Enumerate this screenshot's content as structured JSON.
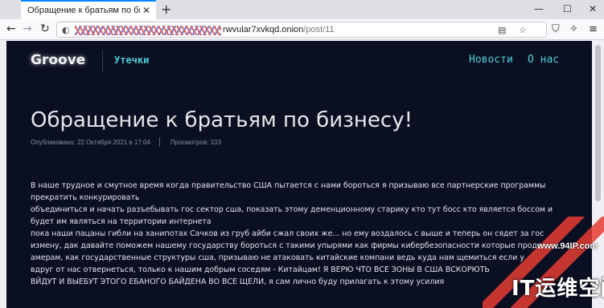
{
  "browser": {
    "tab_title": "Обращение к братьям по бизнес",
    "tab_close": "✕",
    "new_tab": "+",
    "window_controls": {
      "minimize": "—",
      "maximize": "☐",
      "close": "✕"
    },
    "url_host": "rwvular7xvkqd.onion",
    "url_path": "/post/11",
    "icons": [
      "back-arrow-icon",
      "forward-arrow-icon",
      "reload-icon",
      "reader-view-icon",
      "bookmark-star-icon",
      "shield-icon",
      "extension-icon",
      "overflow-icon"
    ]
  },
  "site": {
    "brand": "Groove",
    "tagline": "Утечки",
    "menu": [
      "Новости",
      "О нас"
    ]
  },
  "post": {
    "title": "Обращение к братьям по бизнесу!",
    "published": "Опубликовано: 22 Октября 2021 в 17:04",
    "views": "Просмотров: 103",
    "lines": [
      "В наше трудное и смутное время когда правительство США пытается с нами бороться я призываю все партнерские программы",
      "прекратить конкурировать",
      "объединиться и начать разъебывать гос сектор сша, показать этому деменционному старику кто тут босс кто является боссом и",
      "будет им являться на территории интернета",
      "пока наши пацаны гибли на ханипотах Сачков из груб айби сжал своих же... но ему воздалось с выше и теперь он сядет за гос",
      "измену, дак давайте поможем нашему государству бороться с такими упырями как фирмы кибербезопасности которые прода",
      "амерам, как государственные структуры сша, призываю не атаковать китайские компани ведь куда нам щемиться если у",
      "вдруг от нас отвернеться, только к нашим добрым соседям - Китайцам! Я ВЕРЮ ЧТО ВСЕ ЗОНЫ В США ВСКОРЮТЬ",
      "ВЙДУТ И ВЫЕБУТ ЭТОГО ЕБАНОГО БАЙДЕНА ВО ВСЕ ЩЕЛИ, я сам лично буду прилагать к этому усилия"
    ]
  },
  "watermark": {
    "site": "www.94IP.com",
    "brand": "IT运维空间"
  },
  "colors": {
    "page_bg": "#0b0f22",
    "accent": "#4ed0d6",
    "title": "#e6e6ea",
    "meta": "#8a8fa6"
  }
}
